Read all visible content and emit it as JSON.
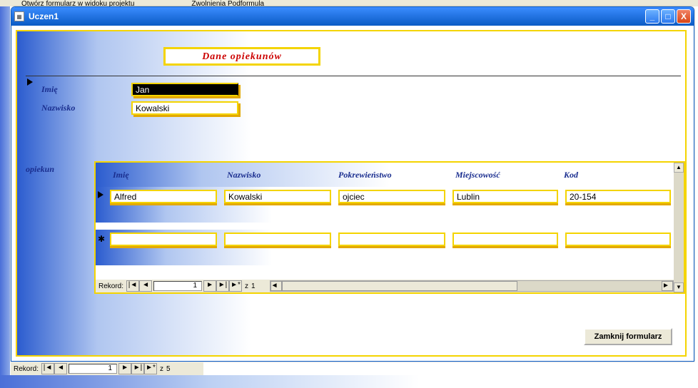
{
  "bg": {
    "menu1": "Otwórz formularz w widoku projektu",
    "menu2": "Zwolnienia Podformula"
  },
  "window": {
    "title": "Uczen1"
  },
  "form": {
    "title": "Dane opiekunów",
    "imie_label": "Imię",
    "nazwisko_label": "Nazwisko",
    "imie_value": "Jan",
    "nazwisko_value": "Kowalski",
    "opiekun_label": "opiekun"
  },
  "sub": {
    "headers": {
      "imie": "Imię",
      "nazwisko": "Nazwisko",
      "pokrew": "Pokrewieństwo",
      "miejsc": "Miejscowość",
      "kod": "Kod"
    },
    "rows": [
      {
        "imie": "Alfred",
        "nazwisko": "Kowalski",
        "pokrew": "ojciec",
        "miejsc": "Lublin",
        "kod": "20-154"
      }
    ]
  },
  "nav": {
    "label": "Rekord:",
    "first": "|◄",
    "prev": "◄",
    "next": "►",
    "last": "►|",
    "new": "►*",
    "of": "z"
  },
  "subnav": {
    "num": "1",
    "total": "1"
  },
  "outernav": {
    "num": "1",
    "total": "5"
  },
  "buttons": {
    "close": "Zamknij formularz"
  }
}
